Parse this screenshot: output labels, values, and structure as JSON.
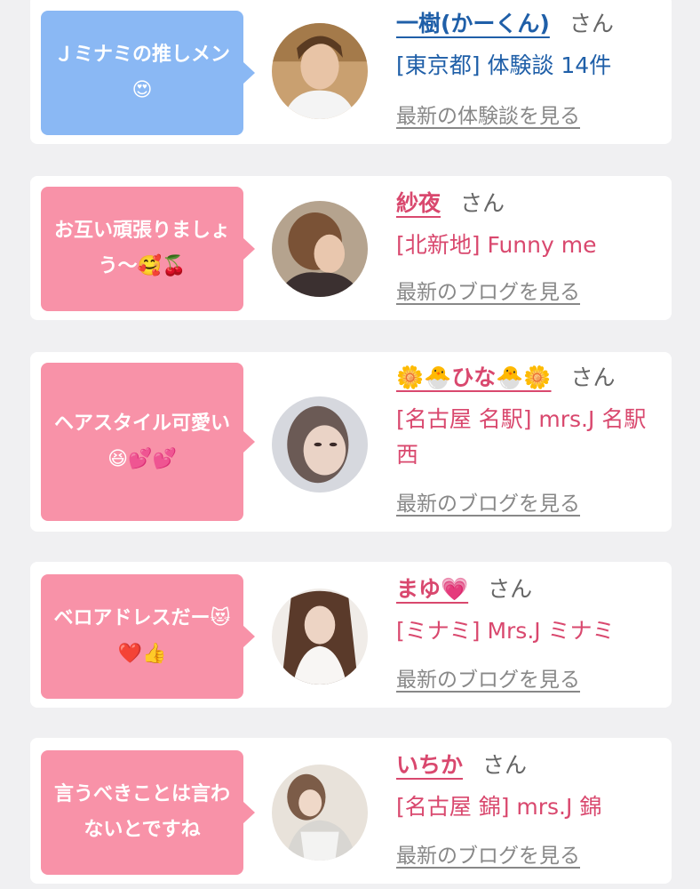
{
  "colors": {
    "blue_bubble": "#8ab8f4",
    "pink_bubble": "#f892a8",
    "blue_text": "#1f5fa8",
    "pink_text": "#d9486e"
  },
  "san_label": "さん",
  "cards": [
    {
      "bubble": "Ｊミナミの推しメン😍",
      "name": "一樹(かーくん)",
      "place": "[東京都] 体験談 14件",
      "link": "最新の体験談を見る"
    },
    {
      "bubble": "お互い頑張りましょう〜🥰🍒",
      "name": "紗夜",
      "place": "[北新地] Funny me",
      "link": "最新のブログを見る"
    },
    {
      "bubble": "ヘアスタイル可愛い😆💕💕",
      "name": "🌼🐣ひな🐣🌼",
      "place": "[名古屋 名駅] mrs.J 名駅西",
      "link": "最新のブログを見る"
    },
    {
      "bubble": "ベロアドレスだー😻❤️👍",
      "name": "まゆ💗",
      "place": "[ミナミ] Mrs.J ミナミ",
      "link": "最新のブログを見る"
    },
    {
      "bubble": "言うべきことは言わないとですね",
      "name": "いちか",
      "place": "[名古屋 錦] mrs.J 錦",
      "link": "最新のブログを見る"
    }
  ]
}
